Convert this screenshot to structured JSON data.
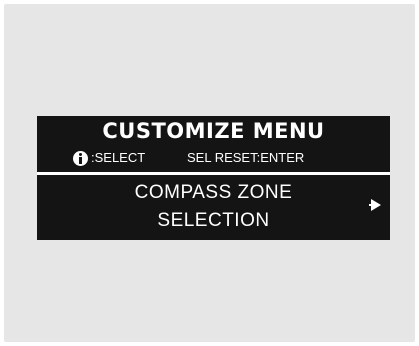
{
  "screen": {
    "title": "CUSTOMIZE MENU",
    "hint": {
      "icon": "info-icon",
      "select_text": ":SELECT",
      "enter_text": "SEL RESET:ENTER"
    },
    "menu_item": {
      "line1": "COMPASS ZONE",
      "line2": "SELECTION",
      "arrow_icon": "right-arrow-icon"
    }
  },
  "colors": {
    "display_background": "#141414",
    "text": "#ffffff",
    "frame_background": "#e6e6e6"
  }
}
